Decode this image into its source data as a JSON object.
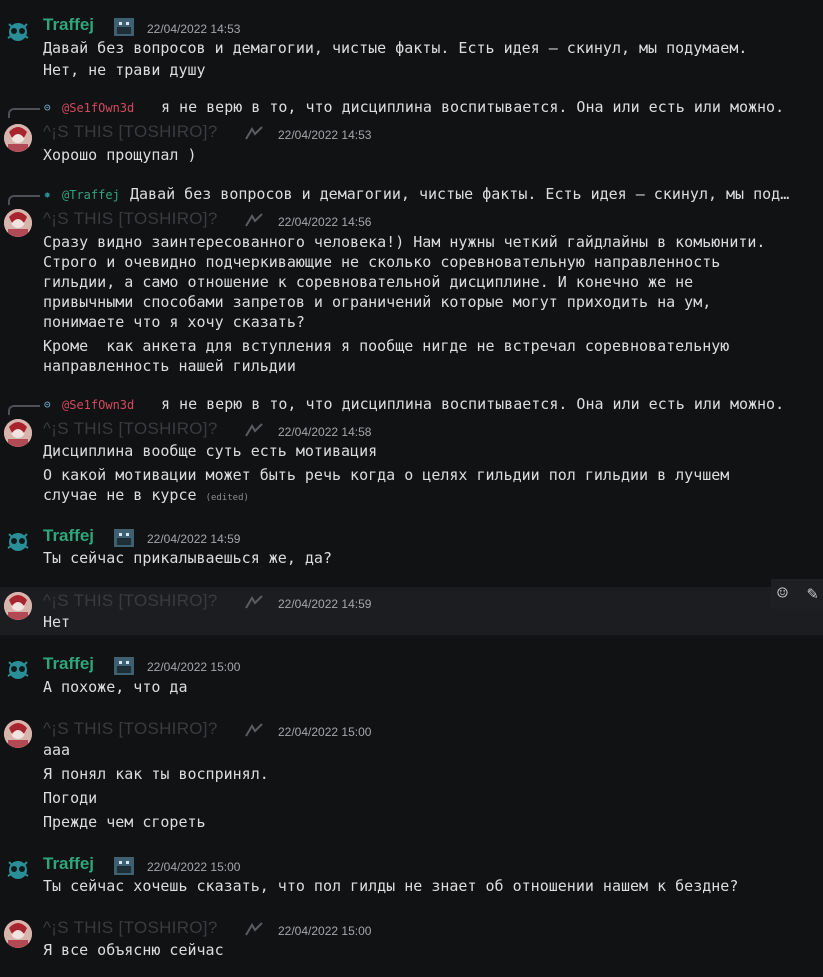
{
  "users": {
    "traffej": {
      "name": "Traffej",
      "color": "#2fa57a"
    },
    "toshiro": {
      "name": "^¡S THIS [TOSHIRO]?",
      "color": "#3a3b3e"
    }
  },
  "messages": [
    {
      "author": "Traffej",
      "time": "22/04/2022 14:53",
      "lines": [
        "Давай без вопросов и демагогии, чистые факты. Есть идея – скинул, мы подумаем.",
        "Нет, не трави душу"
      ]
    },
    {
      "reply": {
        "mention": "@Se1fOwn3d",
        "text": "я не верю в то, что дисциплина воспитывается. Она или есть  или можно."
      },
      "author": "^¡S THIS [TOSHIRO]?",
      "time": "22/04/2022 14:53",
      "lines": [
        "Хорошо прощупал )"
      ]
    },
    {
      "reply": {
        "mention": "@Traffej",
        "text": "Давай без вопросов и демагогии, чистые факты. Есть идея – скинул, мы под…"
      },
      "author": "^¡S THIS [TOSHIRO]?",
      "time": "22/04/2022 14:56",
      "lines": [
        "Сразу видно заинтересованного человека!) Нам нужны четкий гайдлайны в комьюнити.",
        "Строго и очевидно подчеркивающие не сколько соревновательную направленность",
        "гильдии, а само отношение к соревновательной дисциплине. И конечно же не",
        "привычными способами запретов и ограничений которые могут приходить на ум,",
        "понимаете что я хочу сказать?"
      ],
      "lines2": [
        "Кроме  как анкета для вступления я пообще нигде не встречал соревновательную",
        "направленность нашей гильдии"
      ]
    },
    {
      "reply": {
        "mention": "@Se1fOwn3d",
        "text": "я не верю в то, что дисциплина воспитывается. Она или есть  или можно."
      },
      "author": "^¡S THIS [TOSHIRO]?",
      "time": "22/04/2022 14:58",
      "lines": [
        "Дисциплина вообще суть есть мотивация"
      ],
      "lines2": [
        "О какой мотивации может быть речь когда о целях гильдии пол гильдии в лучшем",
        "случае не в курсе "
      ],
      "edited": "(edited)"
    },
    {
      "author": "Traffej",
      "time": "22/04/2022 14:59",
      "lines": [
        "Ты сейчас прикалываешься же, да?"
      ]
    },
    {
      "author": "^¡S THIS [TOSHIRO]?",
      "time": "22/04/2022 14:59",
      "lines": [
        "Нет"
      ]
    },
    {
      "author": "Traffej",
      "time": "22/04/2022 15:00",
      "lines": [
        "А похоже, что да"
      ]
    },
    {
      "author": "^¡S THIS [TOSHIRO]?",
      "time": "22/04/2022 15:00",
      "lines": [
        "ааа"
      ],
      "extra": [
        "Я понял как ты воспринял.",
        "Погоди",
        "Прежде чем сгореть"
      ]
    },
    {
      "author": "Traffej",
      "time": "22/04/2022 15:00",
      "lines": [
        "Ты сейчас хочешь сказать, что пол гилды не знает об отношении нашем к бездне?"
      ]
    },
    {
      "author": "^¡S THIS [TOSHIRO]?",
      "time": "22/04/2022 15:00",
      "lines": [
        "Я все объясню сейчас"
      ]
    }
  ],
  "icons": {
    "reaction": "add-reaction-icon",
    "edit": "pencil-icon",
    "reply_icon": "reply-icon"
  }
}
